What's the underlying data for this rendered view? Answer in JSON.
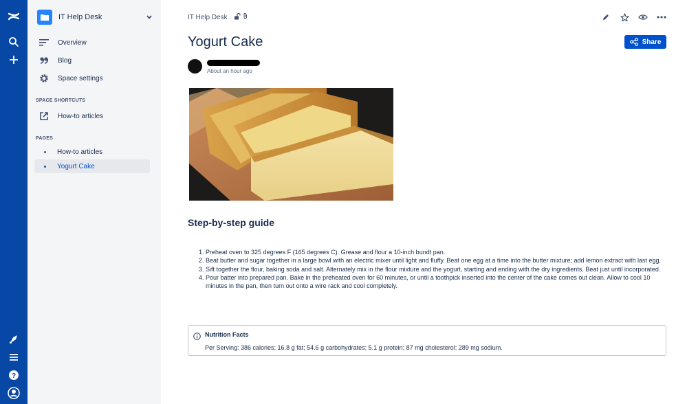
{
  "rail": {
    "icons": [
      "confluence-logo-icon",
      "search-icon",
      "create-icon",
      "notifications-icon",
      "menu-icon",
      "help-icon",
      "profile-icon"
    ]
  },
  "sidebar": {
    "space_name": "IT Help Desk",
    "nav": [
      {
        "label": "Overview",
        "icon": "overview-icon"
      },
      {
        "label": "Blog",
        "icon": "blog-quote-icon"
      },
      {
        "label": "Space settings",
        "icon": "gear-icon"
      }
    ],
    "shortcuts_title": "SPACE SHORTCUTS",
    "shortcuts": [
      {
        "label": "How-to articles",
        "icon": "external-link-icon"
      }
    ],
    "pages_title": "PAGES",
    "pages": [
      {
        "label": "How-to articles",
        "active": false
      },
      {
        "label": "Yogurt Cake",
        "active": true
      }
    ]
  },
  "header": {
    "breadcrumb": "IT Help Desk",
    "share_label": "Share"
  },
  "page": {
    "title": "Yogurt Cake",
    "timestamp": "About an hour ago",
    "section_heading": "Step-by-step guide",
    "steps": [
      "Preheat oven to 325 degrees F (165 degrees C). Grease and flour a 10-inch bundt pan.",
      "Beat butter and sugar together in a large bowl with an electric mixer until light and fluffy. Beat one egg at a time into the butter mixture; add lemon extract with last egg.",
      "Sift together the flour, baking soda and salt. Alternately mix in the flour mixture and the yogurt, starting and ending with the dry ingredients. Beat just until incorporated.",
      "Pour batter into prepared pan. Bake in the preheated oven for 60 minutes, or until a toothpick inserted into the center of the cake comes out clean. Allow to cool 10 minutes in the pan, then turn out onto a wire rack and cool completely."
    ],
    "panel": {
      "title": "Nutrition Facts",
      "body": "Per Serving: 386 calories; 16.8 g fat; 54.6 g carbohydrates; 5.1 g protein; 87 mg cholesterol; 289 mg sodium."
    }
  },
  "colors": {
    "rail": "#0747a6",
    "accent": "#0052cc",
    "sidebar_bg": "#f4f5f7",
    "text": "#172b4d"
  }
}
